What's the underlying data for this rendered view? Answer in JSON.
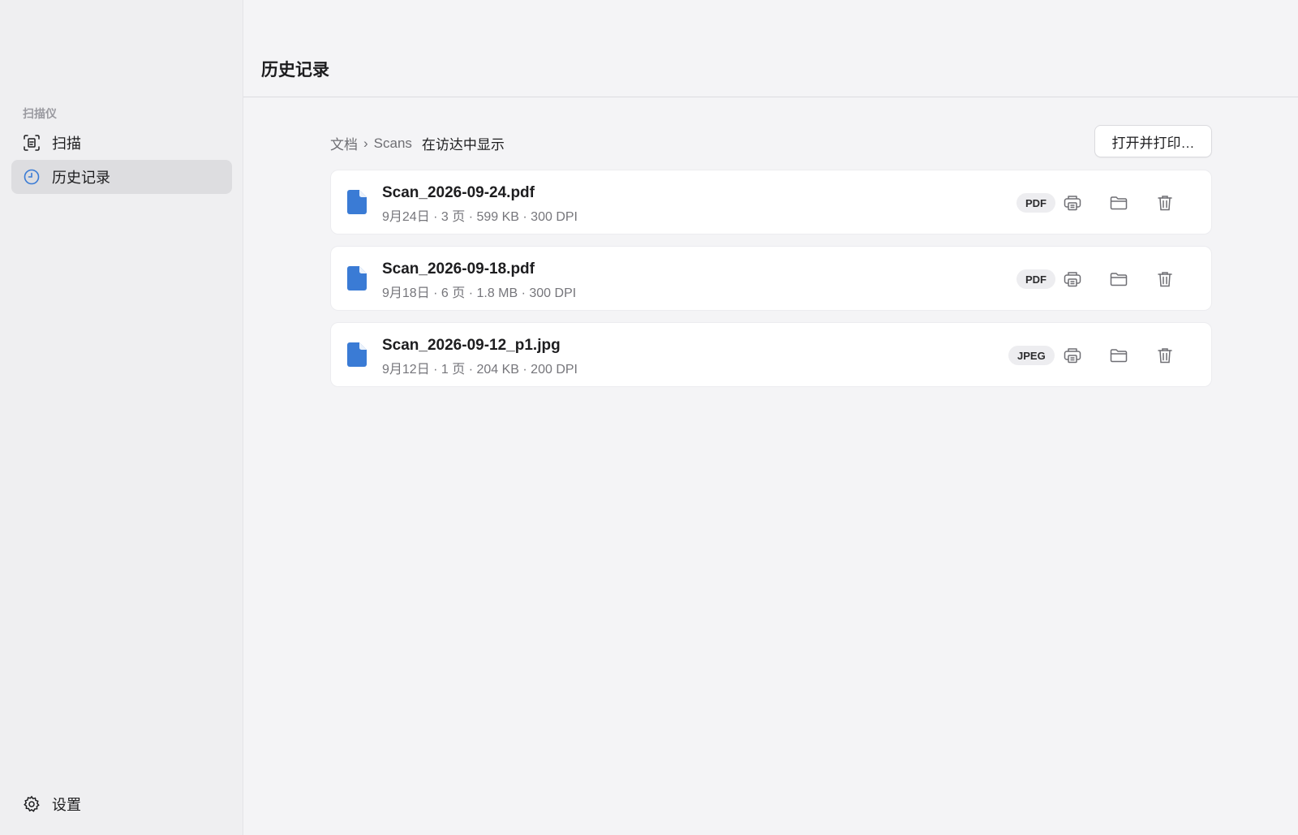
{
  "sidebar": {
    "section_title": "扫描仪",
    "items": [
      {
        "label": "扫描",
        "icon": "document-scan-icon"
      },
      {
        "label": "历史记录",
        "icon": "clock-icon"
      }
    ],
    "settings": {
      "label": "设置",
      "icon": "gear-icon"
    }
  },
  "main": {
    "title": "历史记录",
    "breadcrumb": {
      "root": "文档",
      "separator": "›",
      "folder": "Scans",
      "reveal_in_finder": "在访达中显示"
    },
    "open_print_button": "打开并打印…",
    "files": [
      {
        "name": "Scan_2026-09-24.pdf",
        "meta": "9月24日 · 3 页 · 599 KB · 300 DPI",
        "badge": "PDF"
      },
      {
        "name": "Scan_2026-09-18.pdf",
        "meta": "9月18日 · 6 页 · 1.8 MB · 300 DPI",
        "badge": "PDF"
      },
      {
        "name": "Scan_2026-09-12_p1.jpg",
        "meta": "9月12日 · 1 页 · 204 KB · 200 DPI",
        "badge": "JPEG"
      }
    ]
  },
  "colors": {
    "accent": "#3a7bd5",
    "sidebar_bg": "#efeff1",
    "main_bg": "#f4f4f6",
    "selected_bg": "#dddde0"
  }
}
